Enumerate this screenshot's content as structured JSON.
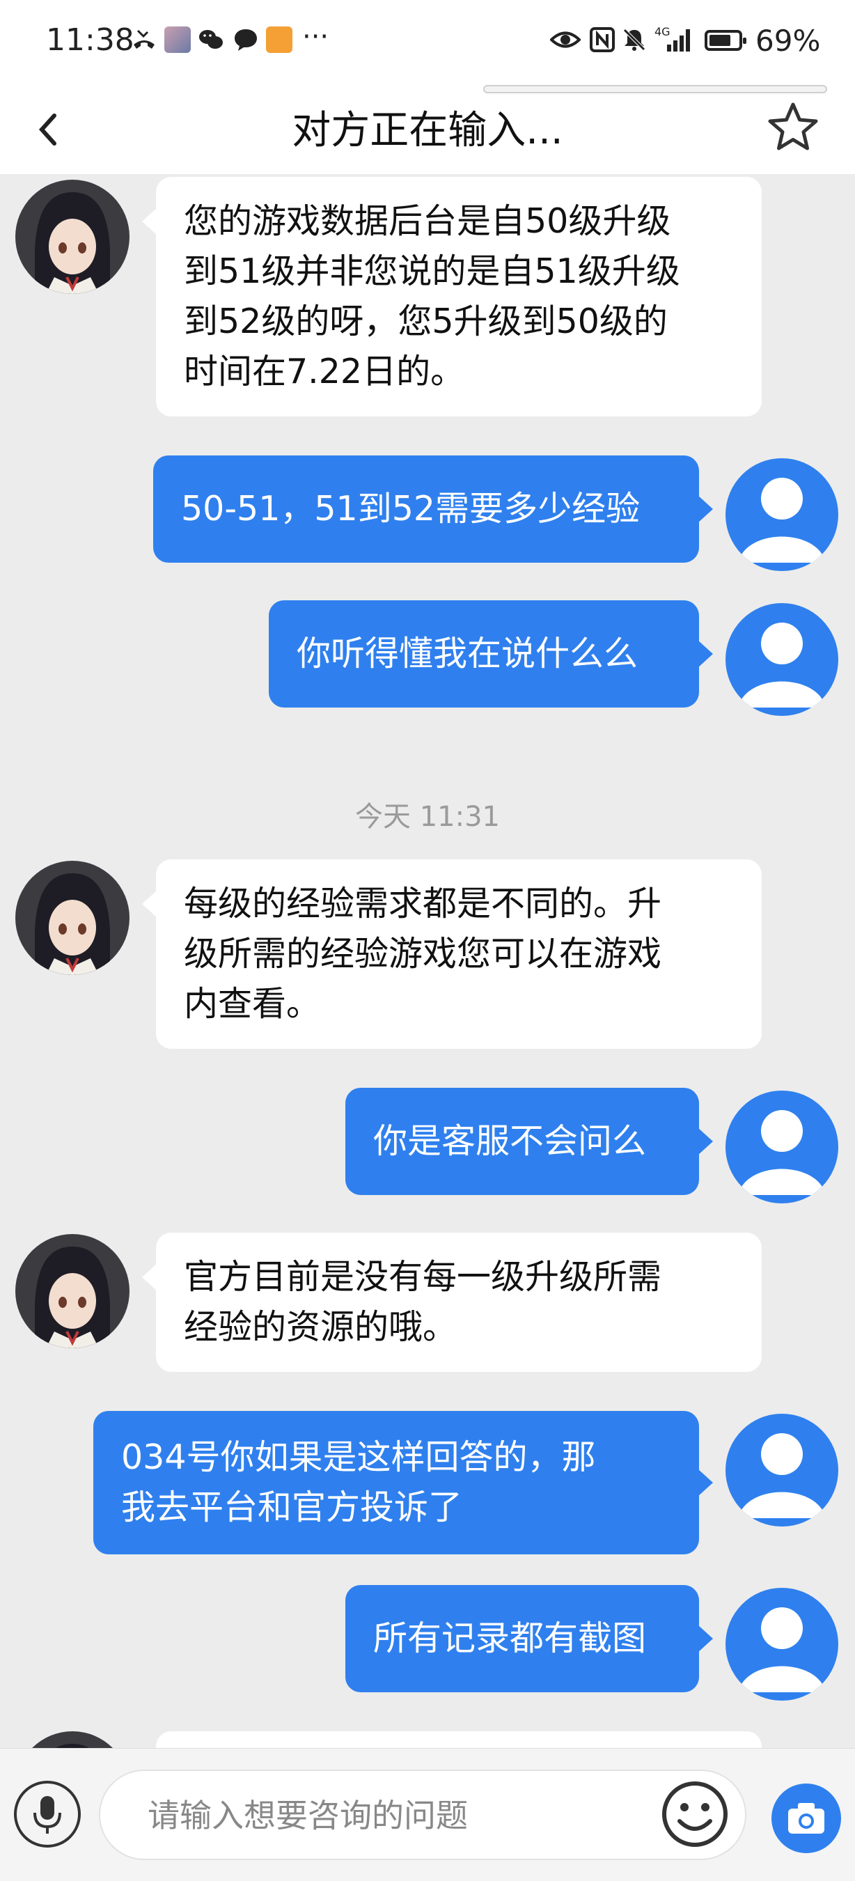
{
  "status_bar": {
    "time": "11:38",
    "more": "···",
    "signal": "4G",
    "battery_percent": "69%"
  },
  "nav": {
    "title": "对方正在输入..."
  },
  "messages": [
    {
      "from": "agent",
      "text": "您的游戏数据后台是自50级升级\n到51级并非您说的是自51级升级\n到52级的呀，您5升级到50级的\n时间在7.22日的。"
    },
    {
      "from": "user",
      "text": "50-51，51到52需要多少经验"
    },
    {
      "from": "user",
      "text": "你听得懂我在说什么么"
    },
    {
      "from": "time",
      "text": "今天 11:31"
    },
    {
      "from": "agent",
      "text": "每级的经验需求都是不同的。升\n级所需的经验游戏您可以在游戏\n内查看。"
    },
    {
      "from": "user",
      "text": "你是客服不会问么"
    },
    {
      "from": "agent",
      "text": "官方目前是没有每一级升级所需\n经验的资源的哦。"
    },
    {
      "from": "user",
      "text": "034号你如果是这样回答的，那\n我去平台和官方投诉了"
    },
    {
      "from": "user",
      "text": "所有记录都有截图"
    }
  ],
  "input": {
    "placeholder": "请输入想要咨询的问题"
  },
  "colors": {
    "accent": "#2f80ee",
    "background": "#ececec"
  }
}
